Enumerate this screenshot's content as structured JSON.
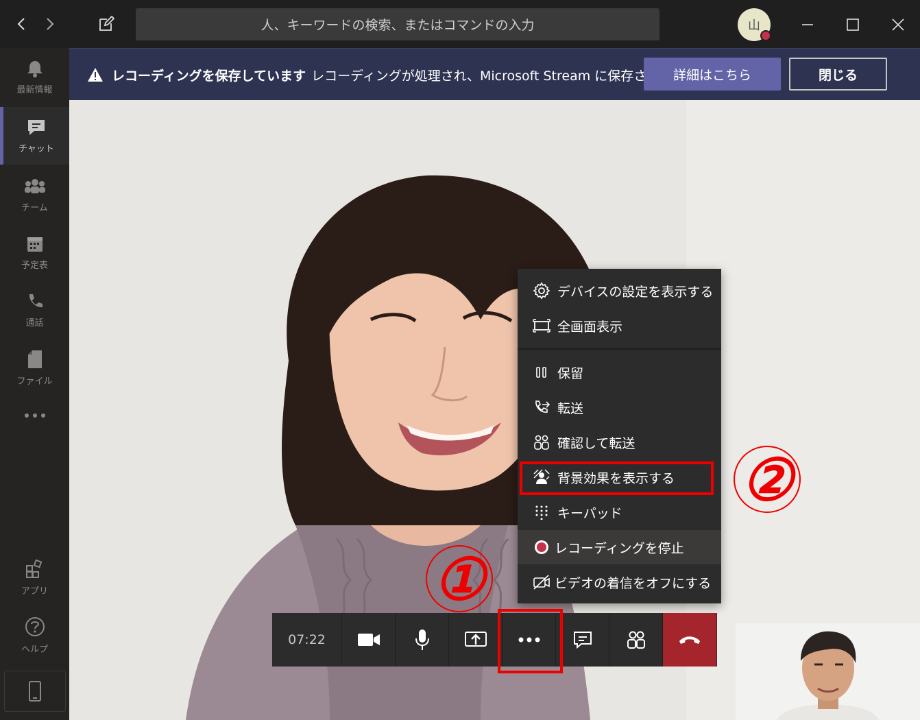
{
  "topbar": {
    "search_placeholder": "人、キーワードの検索、またはコマンドの入力",
    "avatar_initial": "山"
  },
  "rail": {
    "items": [
      {
        "label": "最新情報"
      },
      {
        "label": "チャット"
      },
      {
        "label": "チーム"
      },
      {
        "label": "予定表"
      },
      {
        "label": "通話"
      },
      {
        "label": "ファイル"
      },
      {
        "label": "アプリ"
      },
      {
        "label": "ヘルプ"
      }
    ]
  },
  "banner": {
    "title": "レコーディングを保存しています",
    "message": "レコーディングが処理され、Microsoft Stream に保存さ...",
    "detail_button": "詳細はこちら",
    "close_button": "閉じる"
  },
  "toolbar": {
    "timer": "07:22"
  },
  "menu": {
    "items": [
      {
        "label": "デバイスの設定を表示する",
        "icon": "gear-icon"
      },
      {
        "label": "全画面表示",
        "icon": "fullscreen-icon"
      },
      {
        "label": "保留",
        "icon": "pause-icon"
      },
      {
        "label": "転送",
        "icon": "transfer-icon"
      },
      {
        "label": "確認して転送",
        "icon": "consult-transfer-icon"
      },
      {
        "label": "背景効果を表示する",
        "icon": "background-effects-icon"
      },
      {
        "label": "キーパッド",
        "icon": "keypad-icon"
      },
      {
        "label": "レコーディングを停止",
        "icon": "record-stop-icon"
      },
      {
        "label": "ビデオの着信をオフにする",
        "icon": "video-off-icon"
      }
    ]
  },
  "annotations": {
    "step1": "①",
    "step2": "②",
    "highlight_color": "#e00000"
  },
  "colors": {
    "accent": "#6264a7",
    "hangup": "#a4262c",
    "banner_bg": "#2e3352"
  }
}
